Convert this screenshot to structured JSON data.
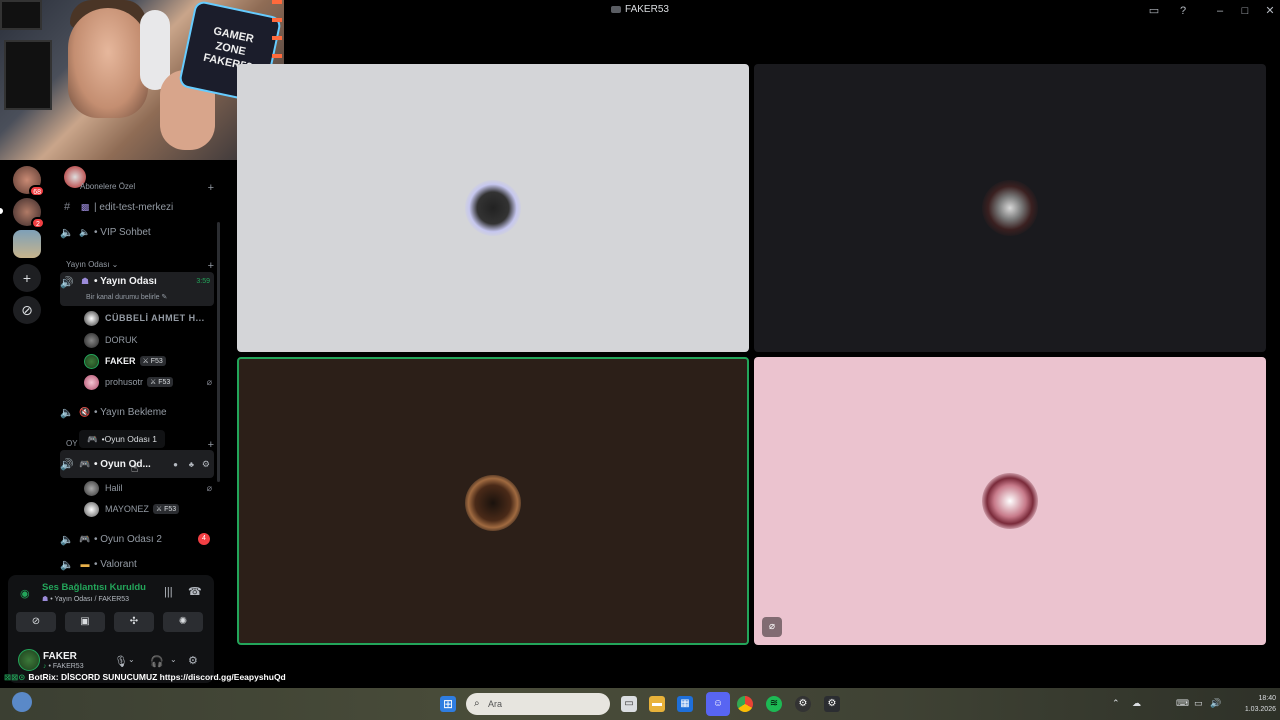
{
  "window": {
    "title": "FAKER53"
  },
  "servers": {
    "badges": [
      "68",
      "2"
    ]
  },
  "channels": {
    "top_category": "Abonelere Özel",
    "top_items": [
      {
        "icon": "text-hash-icon",
        "name": "| edit-test-merkezi"
      },
      {
        "icon": "voice-speaker-icon",
        "name": "VIP Sohbet"
      }
    ],
    "category_live": "Yayın Odası",
    "live_channel": {
      "name": "Yayın Odası",
      "timer": "3:59",
      "status": "Bir kanal durumu belirle"
    },
    "live_users": [
      {
        "name": "CÜBBELİ AHMET H...",
        "tag": ""
      },
      {
        "name": "DORUK",
        "tag": ""
      },
      {
        "name": "FAKER",
        "tag": "F53"
      },
      {
        "name": "prohusotr",
        "tag": "F53"
      }
    ],
    "standby": "Yayın Bekleme",
    "category_game_prefix": "OY",
    "tooltip": "Oyun Odası 1",
    "game_channel": {
      "name": "Oyun Od..."
    },
    "game_users": [
      {
        "name": "Halil",
        "tag": ""
      },
      {
        "name": "MAYONEZ",
        "tag": "F53"
      }
    ],
    "game2": {
      "name": "Oyun Odası 2",
      "badge": "4"
    },
    "valorant": "Valorant"
  },
  "voice": {
    "status": "Ses Bağlantısı Kuruldu",
    "channel_path": "Yayın Odası / FAKER53",
    "user_name": "FAKER",
    "user_sub": "FAKER53"
  },
  "bot_line": {
    "name": "BotRix",
    "message": ": DİSCORD SUNUCUMUZ https://discord.gg/EeapyshuQd"
  },
  "taskbar": {
    "search_placeholder": "Ara",
    "clock_time": "18:40",
    "clock_date": "1.03.2026"
  },
  "colors": {
    "speaking_green": "#23a55a",
    "tile_1": "#d4d5d8",
    "tile_2": "#1a1a1e",
    "tile_3": "#2c1f18",
    "tile_4": "#ebc3cf"
  }
}
